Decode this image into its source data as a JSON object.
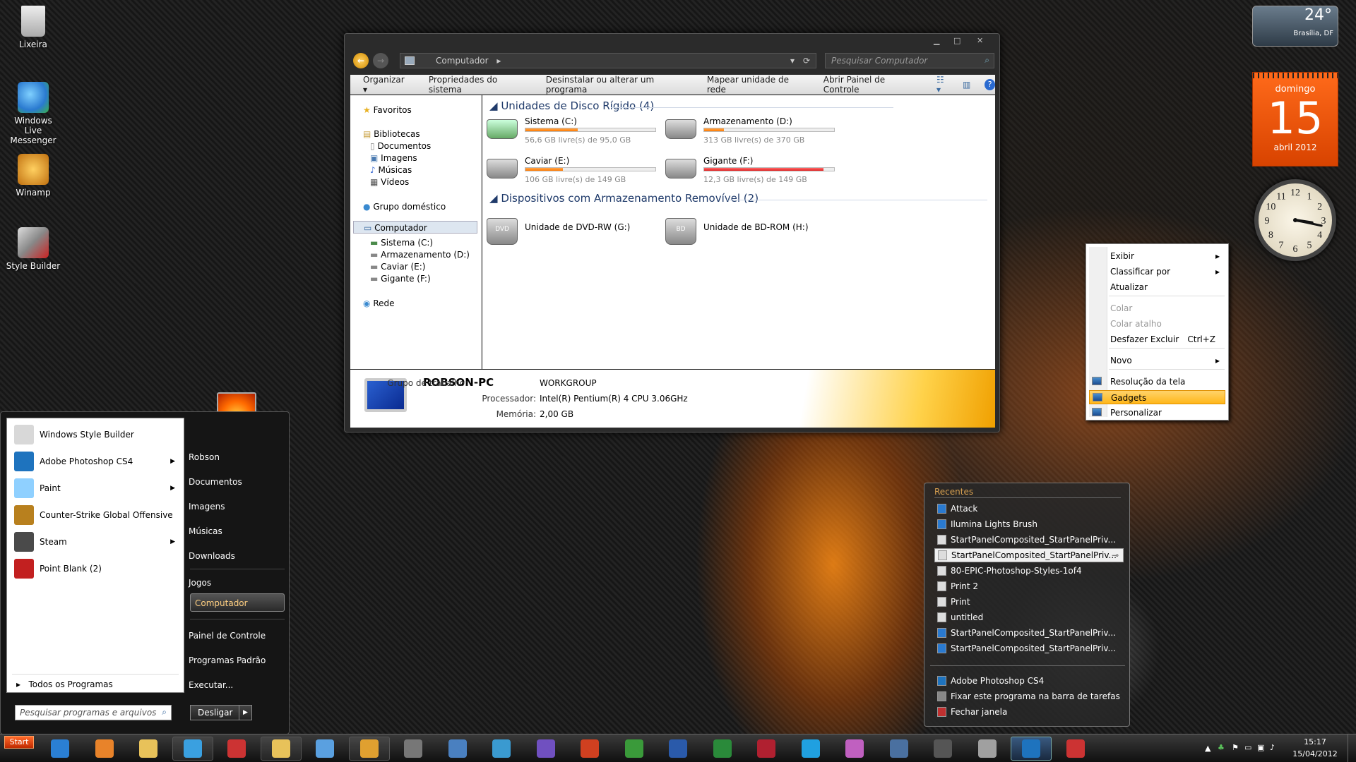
{
  "desktop": {
    "icons": [
      {
        "label": "Lixeira",
        "icon": "recycle-bin-icon"
      },
      {
        "label": "Windows Live Messenger",
        "icon": "messenger-icon"
      },
      {
        "label": "Winamp",
        "icon": "winamp-icon"
      },
      {
        "label": "Style Builder",
        "icon": "style-builder-icon"
      }
    ]
  },
  "explorer": {
    "address": "Computador",
    "search_placeholder": "Pesquisar Computador",
    "toolbar": {
      "organize": "Organizar",
      "system_props": "Propriedades do sistema",
      "uninstall": "Desinstalar ou alterar um programa",
      "map_drive": "Mapear unidade de rede",
      "control_panel": "Abrir Painel de Controle"
    },
    "nav": {
      "favorites": "Favoritos",
      "libraries": "Bibliotecas",
      "documents": "Documentos",
      "images": "Imagens",
      "music": "Músicas",
      "videos": "Vídeos",
      "homegroup": "Grupo doméstico",
      "computer": "Computador",
      "drive_c": "Sistema (C:)",
      "drive_d": "Armazenamento (D:)",
      "drive_e": "Caviar (E:)",
      "drive_f": "Gigante (F:)",
      "network": "Rede"
    },
    "hdd_group": "Unidades de Disco Rígido (4)",
    "removable_group": "Dispositivos com Armazenamento Removível (2)",
    "drives": [
      {
        "name": "Sistema (C:)",
        "free": "56,6 GB livre(s) de 95,0 GB",
        "used_fraction": 0.4,
        "critical": false
      },
      {
        "name": "Armazenamento (D:)",
        "free": "313 GB livre(s) de 370 GB",
        "used_fraction": 0.15,
        "critical": false
      },
      {
        "name": "Caviar (E:)",
        "free": "106 GB livre(s) de 149 GB",
        "used_fraction": 0.29,
        "critical": false
      },
      {
        "name": "Gigante (F:)",
        "free": "12,3 GB livre(s) de 149 GB",
        "used_fraction": 0.92,
        "critical": true
      }
    ],
    "removable": [
      {
        "name": "Unidade de DVD-RW (G:)",
        "badge": "DVD"
      },
      {
        "name": "Unidade de BD-ROM (H:)",
        "badge": "BD"
      }
    ],
    "details": {
      "pc_name": "ROBSON-PC",
      "workgroup_label": "Grupo de trabalho:",
      "workgroup": "WORKGROUP",
      "cpu_label": "Processador:",
      "cpu": "Intel(R) Pentium(R) 4 CPU 3.06GHz",
      "mem_label": "Memória:",
      "mem": "2,00 GB"
    }
  },
  "start_menu": {
    "pinned": [
      {
        "label": "Windows Style Builder",
        "arrow": false,
        "color": "#d8d8d8"
      },
      {
        "label": "Adobe Photoshop CS4",
        "arrow": true,
        "color": "#1e73be"
      },
      {
        "label": "Paint",
        "arrow": true,
        "color": "#8fd0ff"
      },
      {
        "label": "Counter-Strike Global Offensive",
        "arrow": false,
        "color": "#b8801e"
      },
      {
        "label": "Steam",
        "arrow": true,
        "color": "#4a4a4a"
      },
      {
        "label": "Point Blank (2)",
        "arrow": false,
        "color": "#c22020"
      }
    ],
    "all_programs": "Todos os Programas",
    "search_placeholder": "Pesquisar programas e arquivos",
    "right": [
      "Robson",
      "Documentos",
      "Imagens",
      "Músicas",
      "Downloads",
      "Jogos",
      "Computador",
      "Painel de Controle",
      "Programas Padrão",
      "Executar..."
    ],
    "shutdown": "Desligar"
  },
  "context_menu": {
    "items": [
      "Exibir",
      "Classificar por",
      "Atualizar",
      "Colar",
      "Colar atalho",
      "Desfazer Excluir",
      "Novo",
      "Resolução da tela",
      "Gadgets",
      "Personalizar"
    ],
    "undo_shortcut": "Ctrl+Z"
  },
  "jump_list": {
    "header": "Recentes",
    "recent": [
      "Attack",
      "Ilumina Lights Brush",
      "StartPanelComposited_StartPanelPriv...",
      "StartPanelComposited_StartPanelPriv...",
      "80-EPIC-Photoshop-Styles-1of4",
      "Print 2",
      "Print",
      "untitled",
      "StartPanelComposited_StartPanelPriv...",
      "StartPanelComposited_StartPanelPriv..."
    ],
    "tasks": [
      "Adobe Photoshop CS4",
      "Fixar este programa na barra de tarefas",
      "Fechar janela"
    ]
  },
  "gadgets": {
    "temp": "24°",
    "city": "Brasília, DF",
    "day_name": "domingo",
    "day": "15",
    "month_year": "abril 2012",
    "clock_time": "15:17"
  },
  "taskbar": {
    "start": "Start",
    "time": "15:17",
    "date": "15/04/2012",
    "apps": [
      {
        "name": "internet-explorer-icon",
        "color": "#2a7fd4"
      },
      {
        "name": "media-player-icon",
        "color": "#e8832a"
      },
      {
        "name": "folder-icon",
        "color": "#e8c25a"
      },
      {
        "name": "windows-icon",
        "color": "#3aa0e0"
      },
      {
        "name": "style-builder-icon",
        "color": "#cc3333"
      },
      {
        "name": "explorer-icon",
        "color": "#e8c25a"
      },
      {
        "name": "messenger-icon",
        "color": "#5aa0e0"
      },
      {
        "name": "winamp-icon",
        "color": "#e0a030"
      },
      {
        "name": "steam-icon",
        "color": "#777777"
      },
      {
        "name": "network-icon",
        "color": "#4a80c0"
      },
      {
        "name": "monitor-icon",
        "color": "#3a9ad0"
      },
      {
        "name": "app-i-icon",
        "color": "#7050c0"
      },
      {
        "name": "burn-icon",
        "color": "#d04020"
      },
      {
        "name": "utorrent-icon",
        "color": "#3a9a3a"
      },
      {
        "name": "word-icon",
        "color": "#2a5aaa"
      },
      {
        "name": "excel-icon",
        "color": "#2a8a3a"
      },
      {
        "name": "access-icon",
        "color": "#b02030"
      },
      {
        "name": "skype-icon",
        "color": "#20a0e0"
      },
      {
        "name": "game-icon",
        "color": "#c060c0"
      },
      {
        "name": "display-icon",
        "color": "#4a70a0"
      },
      {
        "name": "hp-icon",
        "color": "#555555"
      },
      {
        "name": "tools-icon",
        "color": "#a0a0a0"
      },
      {
        "name": "photoshop-icon",
        "color": "#1e73be"
      },
      {
        "name": "style-builder-2-icon",
        "color": "#cc3333"
      }
    ]
  }
}
